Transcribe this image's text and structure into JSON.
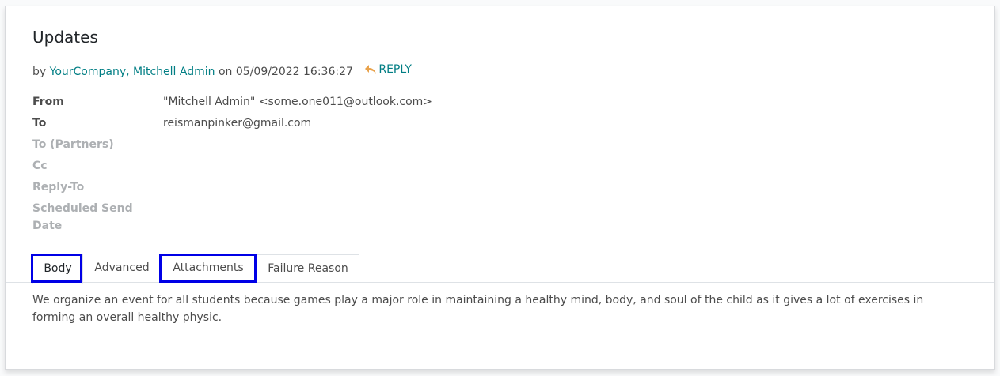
{
  "title": "Updates",
  "meta": {
    "by": "by",
    "author": "YourCompany, Mitchell Admin",
    "on": "on",
    "datetime": "05/09/2022 16:36:27",
    "reply": "REPLY"
  },
  "fields": [
    {
      "label": "From",
      "value": "\"Mitchell Admin\" <some.one011@outlook.com>"
    },
    {
      "label": "To",
      "value": "reismanpinker@gmail.com"
    },
    {
      "label": "To (Partners)",
      "value": ""
    },
    {
      "label": "Cc",
      "value": ""
    },
    {
      "label": "Reply-To",
      "value": ""
    },
    {
      "label": "Scheduled Send Date",
      "value": ""
    }
  ],
  "tabs": [
    {
      "label": "Body",
      "active": true,
      "highlighted": true
    },
    {
      "label": "Advanced",
      "active": false,
      "highlighted": false
    },
    {
      "label": "Attachments",
      "active": false,
      "highlighted": true
    },
    {
      "label": "Failure Reason",
      "active": false,
      "highlighted": false
    }
  ],
  "body": "We organize an event for all students because games play a major role in maintaining a healthy mind, body, and soul of the child as it gives a lot of exercises in forming an overall healthy physic.",
  "colors": {
    "link": "#017e84",
    "reply_icon": "#e9a24b",
    "highlight": "#0000e6"
  }
}
